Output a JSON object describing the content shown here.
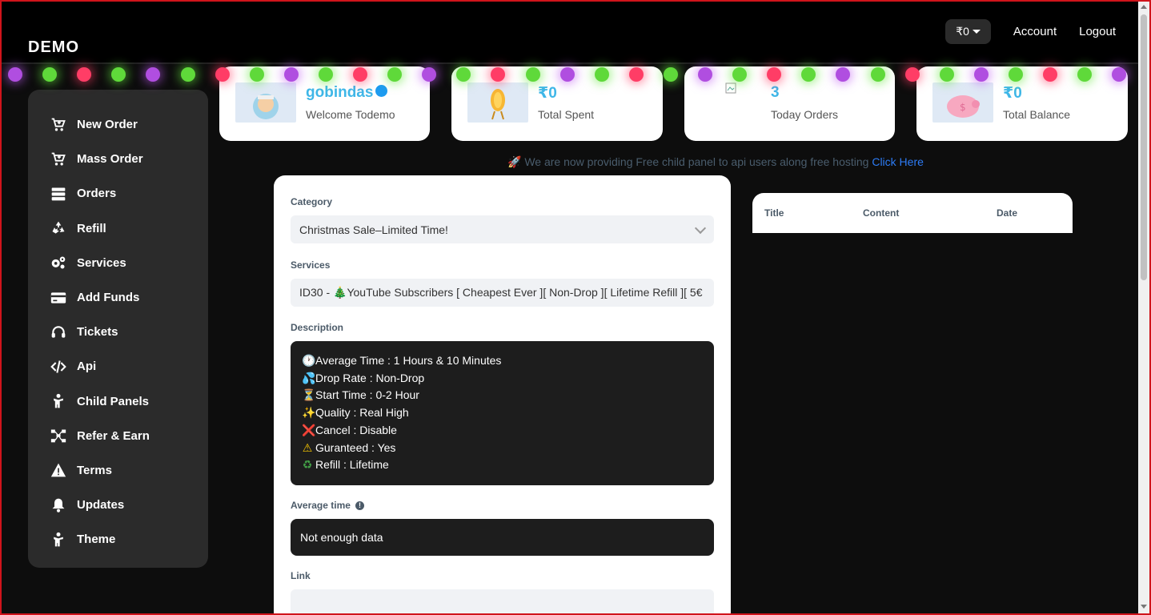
{
  "brand": "DEMO",
  "nav": {
    "balance": "₹0",
    "account": "Account",
    "logout": "Logout"
  },
  "colors": {
    "accent": "#3fb7e8",
    "link": "#2d7cf6",
    "frame": "#d0141b"
  },
  "sidebar": {
    "items": [
      {
        "label": "New Order",
        "icon": "cart-icon"
      },
      {
        "label": "Mass Order",
        "icon": "cart-icon"
      },
      {
        "label": "Orders",
        "icon": "server-icon"
      },
      {
        "label": "Refill",
        "icon": "recycle-icon"
      },
      {
        "label": "Services",
        "icon": "gears-icon"
      },
      {
        "label": "Add Funds",
        "icon": "credit-card-icon"
      },
      {
        "label": "Tickets",
        "icon": "headset-icon"
      },
      {
        "label": "Api",
        "icon": "code-icon"
      },
      {
        "label": "Child Panels",
        "icon": "child-icon"
      },
      {
        "label": "Refer & Earn",
        "icon": "network-icon"
      },
      {
        "label": "Terms",
        "icon": "warning-icon"
      },
      {
        "label": "Updates",
        "icon": "bell-icon"
      },
      {
        "label": "Theme",
        "icon": "child-icon"
      }
    ]
  },
  "stats": {
    "user": {
      "value": "gobindas",
      "label": "Welcome Todemo"
    },
    "spent": {
      "value": "₹0",
      "label": "Total Spent"
    },
    "orders": {
      "value": "3",
      "label": "Today Orders"
    },
    "balance": {
      "value": "₹0",
      "label": "Total Balance"
    }
  },
  "promo": {
    "text": "We are now providing Free child panel to api users along free hosting",
    "link": "Click Here"
  },
  "order_form": {
    "category_label": "Category",
    "category_value": "Christmas Sale–Limited Time!",
    "services_label": "Services",
    "services_value": "ID30 - 🎄YouTube Subscribers [ Cheapest Ever ][ Non-Drop ][ Lifetime Refill ][ 5€",
    "description_label": "Description",
    "description_lines": [
      {
        "icon": "🕐",
        "text": "Average Time : 1 Hours & 10 Minutes"
      },
      {
        "icon": "💦",
        "text": "Drop Rate : Non-Drop"
      },
      {
        "icon": "⏳",
        "text": "Start Time : 0-2 Hour"
      },
      {
        "icon": "✨",
        "text": "Quality : Real High"
      },
      {
        "icon": "❌",
        "text": "Cancel : Disable"
      },
      {
        "icon": "⚠",
        "text": "Guranteed : Yes"
      },
      {
        "icon": "♻",
        "text": "Refill : Lifetime"
      }
    ],
    "avg_time_label": "Average time",
    "avg_time_value": "Not enough data",
    "link_label": "Link",
    "link_value": ""
  },
  "updates_table": {
    "col_title": "Title",
    "col_content": "Content",
    "col_date": "Date"
  }
}
